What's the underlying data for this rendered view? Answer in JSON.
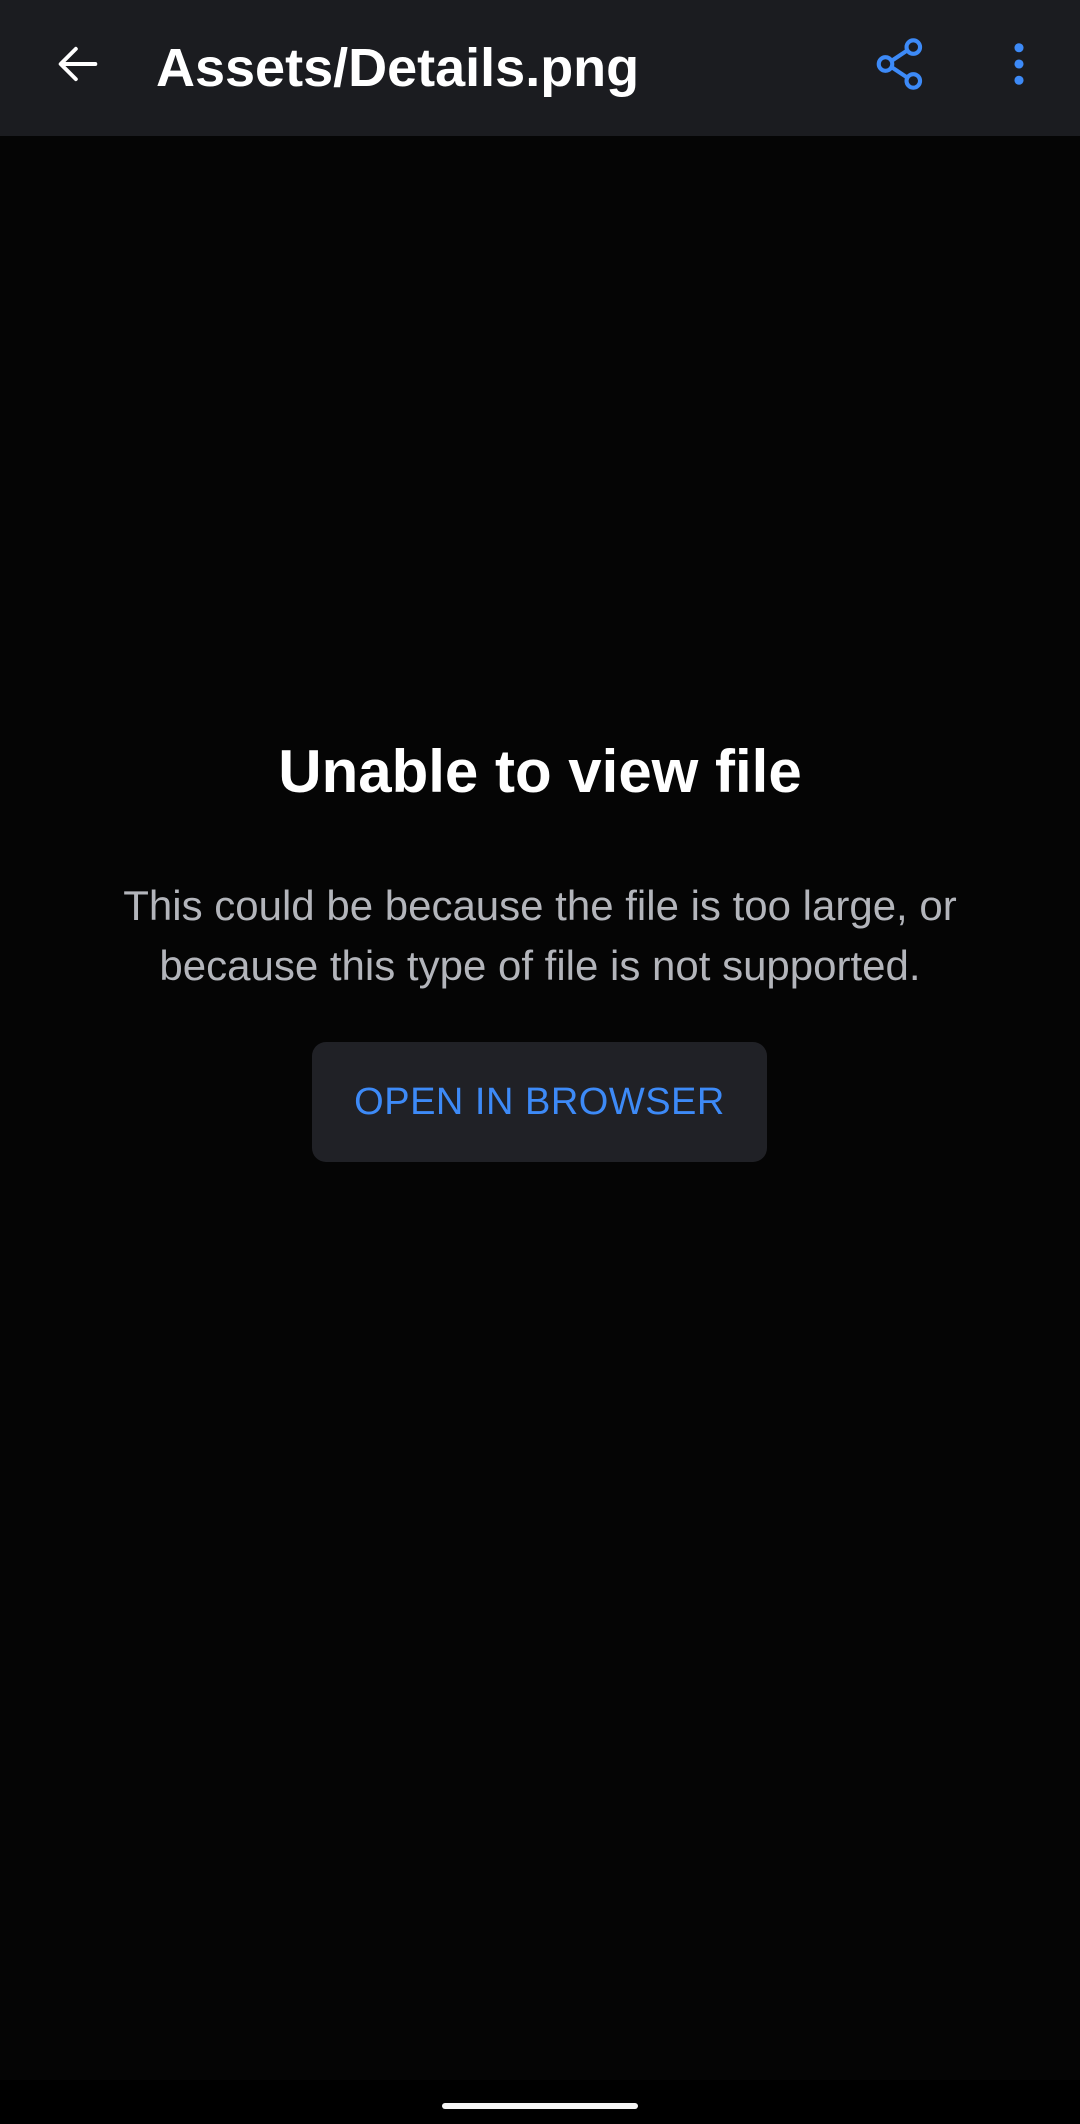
{
  "app_bar": {
    "title": "Assets/Details.png",
    "back_icon": "arrow-left-icon",
    "share_icon": "share-icon",
    "more_icon": "more-vert-icon"
  },
  "empty_state": {
    "title": "Unable to view file",
    "message": "This could be because the file is too large, or because this type of file is not supported.",
    "button_label": "OPEN IN BROWSER"
  },
  "colors": {
    "app_bar_bg": "#1b1c20",
    "background": "#050505",
    "accent": "#3d8af7",
    "title_text": "#ffffff",
    "body_text": "#b3b5bb",
    "button_bg": "#202126"
  }
}
